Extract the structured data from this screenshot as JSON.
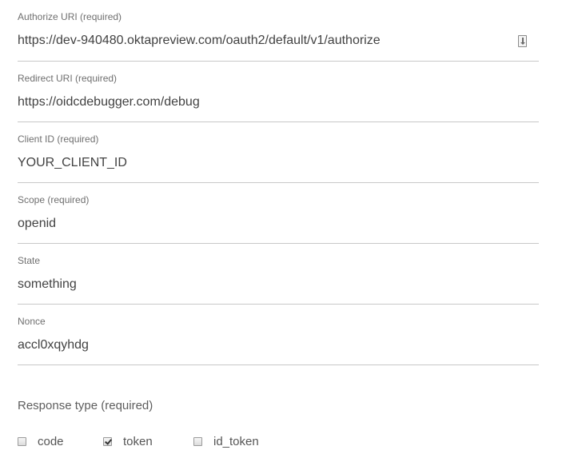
{
  "fields": [
    {
      "label": "Authorize URI (required)",
      "value": "https://dev-940480.oktapreview.com/oauth2/default/v1/authorize"
    },
    {
      "label": "Redirect URI (required)",
      "value": "https://oidcdebugger.com/debug"
    },
    {
      "label": "Client ID (required)",
      "value": "YOUR_CLIENT_ID"
    },
    {
      "label": "Scope (required)",
      "value": "openid"
    },
    {
      "label": "State",
      "value": "something"
    },
    {
      "label": "Nonce",
      "value": "accl0xqyhdg"
    }
  ],
  "response_type": {
    "title": "Response type (required)",
    "options": [
      {
        "label": "code",
        "checked": false
      },
      {
        "label": "token",
        "checked": true
      },
      {
        "label": "id_token",
        "checked": false
      }
    ]
  },
  "icons": {
    "autofill": "autofill-icon"
  }
}
